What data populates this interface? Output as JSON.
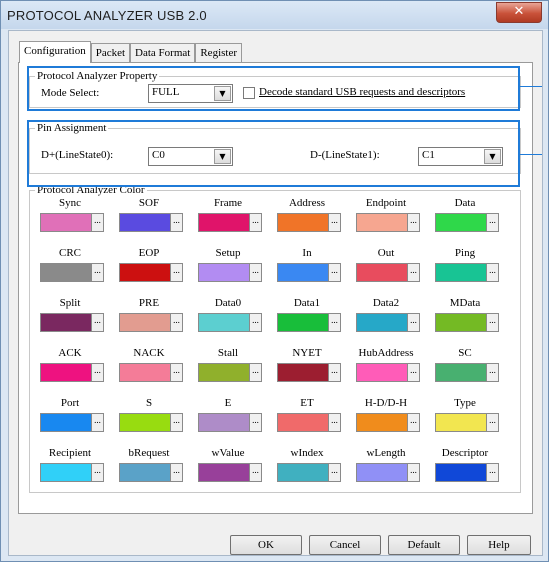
{
  "window": {
    "title": "PROTOCOL ANALYZER USB 2.0",
    "close_glyph": "✕"
  },
  "tabs": [
    {
      "label": "Configuration",
      "active": true
    },
    {
      "label": "Packet"
    },
    {
      "label": "Data Format"
    },
    {
      "label": "Register"
    }
  ],
  "property": {
    "group_title": "Protocol Analyzer Property",
    "mode_label": "Mode Select:",
    "mode_value": "FULL",
    "decode_label": "Decode standard USB requests and descriptors"
  },
  "pins": {
    "group_title": "Pin Assignment",
    "dplus_label": "D+(LineState0):",
    "dplus_value": "C0",
    "dminus_label": "D-(LineState1):",
    "dminus_value": "C1"
  },
  "colors": {
    "group_title": "Protocol Analyzer Color",
    "dots": "...",
    "items": [
      {
        "name": "Sync",
        "color": "#e070b8"
      },
      {
        "name": "SOF",
        "color": "#5a4be0"
      },
      {
        "name": "Frame",
        "color": "#e0146a"
      },
      {
        "name": "Address",
        "color": "#f07428"
      },
      {
        "name": "Endpoint",
        "color": "#f6a690"
      },
      {
        "name": "Data",
        "color": "#2fd84a"
      },
      {
        "name": "CRC",
        "color": "#8a8a8a"
      },
      {
        "name": "EOP",
        "color": "#cc1010"
      },
      {
        "name": "Setup",
        "color": "#b28cf2"
      },
      {
        "name": "In",
        "color": "#3a88f2"
      },
      {
        "name": "Out",
        "color": "#e84c5e"
      },
      {
        "name": "Ping",
        "color": "#18c494"
      },
      {
        "name": "Split",
        "color": "#7a2860"
      },
      {
        "name": "PRE",
        "color": "#e29c90"
      },
      {
        "name": "Data0",
        "color": "#5ccfd0"
      },
      {
        "name": "Data1",
        "color": "#18be3a"
      },
      {
        "name": "Data2",
        "color": "#26a8c8"
      },
      {
        "name": "MData",
        "color": "#74ba24"
      },
      {
        "name": "ACK",
        "color": "#ee1280"
      },
      {
        "name": "NACK",
        "color": "#f47c98"
      },
      {
        "name": "Stall",
        "color": "#90b02c"
      },
      {
        "name": "NYET",
        "color": "#9c1e30"
      },
      {
        "name": "HubAddress",
        "color": "#ff5cb8"
      },
      {
        "name": "SC",
        "color": "#48b070"
      },
      {
        "name": "Port",
        "color": "#1888f0"
      },
      {
        "name": "S",
        "color": "#98dc10"
      },
      {
        "name": "E",
        "color": "#ae8cc8"
      },
      {
        "name": "ET",
        "color": "#f06a6a"
      },
      {
        "name": "H-D/D-H",
        "color": "#f08c1c"
      },
      {
        "name": "Type",
        "color": "#f2e650"
      },
      {
        "name": "Recipient",
        "color": "#30d0f8"
      },
      {
        "name": "bRequest",
        "color": "#5aa2c8"
      },
      {
        "name": "wValue",
        "color": "#98409a"
      },
      {
        "name": "wIndex",
        "color": "#40b0c0"
      },
      {
        "name": "wLength",
        "color": "#9090f6"
      },
      {
        "name": "Descriptor",
        "color": "#1048d8"
      }
    ]
  },
  "buttons": {
    "ok": "OK",
    "cancel": "Cancel",
    "default": "Default",
    "help": "Help"
  }
}
